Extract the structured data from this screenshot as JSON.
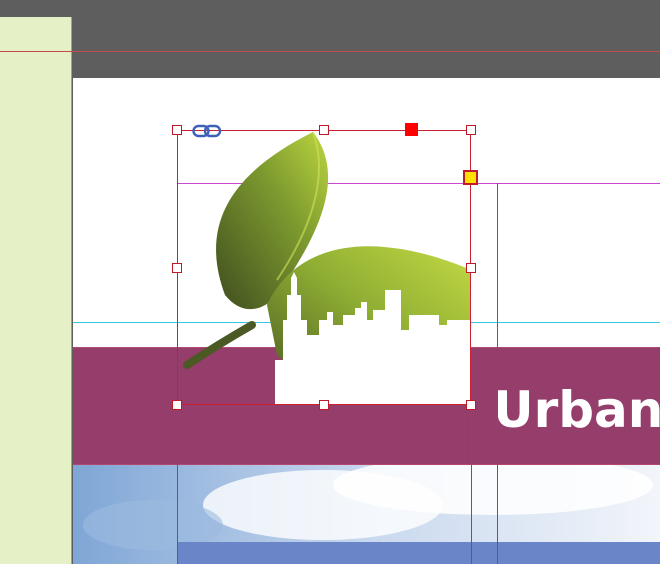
{
  "document": {
    "band_text": "Urban G",
    "colors": {
      "pasteboard": "#5e5e5e",
      "left_panel": "#e6f0c6",
      "band": "#953d6b",
      "selection": "#cc1f2f",
      "margin_guide": "#c94ad2",
      "baseline_guide": "#37c8e6",
      "leaf_light": "#b5d23c",
      "leaf_dark": "#4a5a24",
      "photo_bar": "#6a86c8"
    }
  },
  "selection": {
    "icons": [
      "link-icon",
      "content-grabber-icon",
      "corner-option-icon"
    ]
  }
}
